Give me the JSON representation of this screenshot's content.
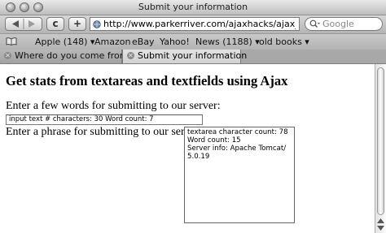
{
  "window": {
    "title": "Submit your information"
  },
  "toolbar": {
    "url": "http://www.parkerriver.com/ajaxhacks/ajax_hac",
    "search_placeholder": "Google",
    "reload_glyph": "c",
    "add_glyph": "+"
  },
  "bookmarks": [
    "Apple (148) ▾",
    "Amazon",
    "eBay",
    "Yahoo!",
    "News (1188) ▾",
    "old books ▾"
  ],
  "tabs": [
    {
      "label": "Where do you come from?",
      "active": false
    },
    {
      "label": "Submit your information",
      "active": true
    }
  ],
  "page": {
    "heading": "Get stats from textareas and textfields using Ajax",
    "textfield_prompt": "Enter a few words for submitting to our server:",
    "textfield_value": "input text # characters: 30 Word count: 7",
    "textarea_prompt": "Enter a phrase for submitting to our server:",
    "textarea_value": "textarea character count: 78\nWord count: 15\nServer info: Apache Tomcat/\n5.0.19"
  }
}
